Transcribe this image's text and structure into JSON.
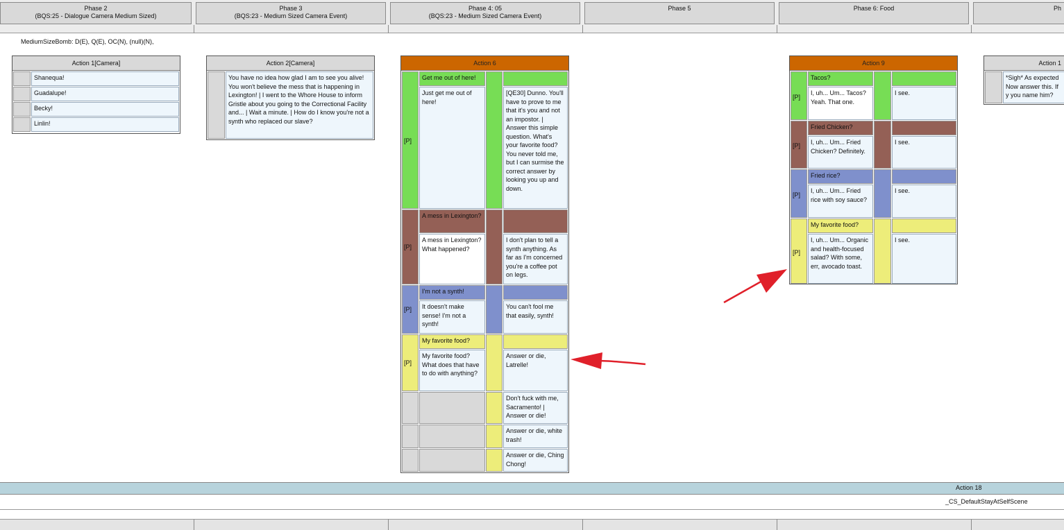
{
  "phases": [
    {
      "title": "Phase 2",
      "subtitle": "(BQS:25 - Dialogue Camera Medium Sized)"
    },
    {
      "title": "Phase 3",
      "subtitle": "(BQS:23 - Medium Sized Camera Event)"
    },
    {
      "title": "Phase 4: 05",
      "subtitle": "(BQS:23 - Medium Sized Camera Event)"
    },
    {
      "title": "Phase 5",
      "subtitle": ""
    },
    {
      "title": "Phase 6: Food",
      "subtitle": ""
    },
    {
      "title": "Ph",
      "subtitle": ""
    }
  ],
  "bomb_line": "MediumSizeBomb: D(E), Q(E), OC(N), (null)(N),",
  "action1": {
    "title": "Action 1[Camera]",
    "rows": [
      "Shanequa!",
      "Guadalupe!",
      "Becky!",
      "Linlin!"
    ]
  },
  "action2": {
    "title": "Action 2[Camera]",
    "text": "You have no idea how glad I am to see you alive! You won't believe the mess that is happening in Lexington! | I went to the Whore House to inform Gristle about you going to the Correctional Facility and... | Wait a minute.  | How do I know you're not a synth who replaced our slave?"
  },
  "action6": {
    "title": "Action 6",
    "p_label": "[P]",
    "options": [
      {
        "header": "Get me out of here!",
        "player": "Just get me out of here!",
        "npc": "[QE30] Dunno. You'll have to prove to me that it's you and not an impostor. | Answer this simple question. What's your favorite food? You never told me, but I can surmise the correct answer by looking you up and down."
      },
      {
        "header": "A mess in Lexington?",
        "player": "A mess in Lexington? What happened?",
        "npc": "I don't plan to tell a synth anything. As far as I'm concerned you're a coffee pot on legs."
      },
      {
        "header": "I'm not a synth!",
        "player": "It doesn't make sense! I'm not a synth!",
        "npc": "You can't fool me that easily, synth!"
      },
      {
        "header": "My favorite food?",
        "player": "My favorite food? What does that have to do with anything?",
        "npc": "Answer or die, Latrelle!"
      }
    ],
    "extra_npc": [
      "Don't fuck with me, Sacramento! | Answer or die!",
      "Answer or die, white trash!",
      "Answer or die, Ching Chong!"
    ]
  },
  "action9": {
    "title": "Action 9",
    "p_label": "[P]",
    "options": [
      {
        "header": "Tacos?",
        "player": "I, uh... Um... Tacos? Yeah. That one.",
        "npc": "I see."
      },
      {
        "header": "Fried Chicken?",
        "player": "I, uh... Um... Fried Chicken? Definitely.",
        "npc": "I see."
      },
      {
        "header": "Fried rice?",
        "player": "I, uh... Um... Fried rice with soy sauce?",
        "npc": "I see."
      },
      {
        "header": "My favorite food?",
        "player": "I, uh... Um... Organic and health-focused salad? With some, err, avocado toast.",
        "npc": "I see."
      }
    ]
  },
  "action_partial": {
    "title": "Action 1",
    "text": "*Sigh* As expected Now answer this. If y you name him?"
  },
  "footer": {
    "action_title": "Action 18",
    "scene": "_CS_DefaultStayAtSelfScene"
  },
  "colors": {
    "green": "#77dd55",
    "brown": "#946056",
    "blue": "#7f90cc",
    "yellow": "#eded7a",
    "orange": "#cc6600",
    "arrow": "#e0202a"
  }
}
